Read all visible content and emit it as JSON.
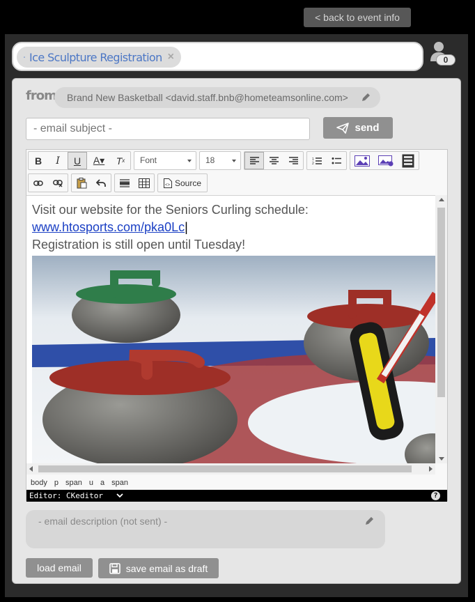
{
  "top": {
    "back_label": "< back to event info"
  },
  "recipients": {
    "chip_label": "Ice Sculpture Registration",
    "close_glyph": "×",
    "count": "0"
  },
  "from": {
    "label": "from:",
    "value": "Brand New Basketball  <david.staff.bnb@hometeamsonline.com>"
  },
  "subject": {
    "placeholder": "- email subject -"
  },
  "send": {
    "label": "send"
  },
  "toolbar": {
    "font_label": "Font",
    "size_label": "18",
    "source_label": "Source"
  },
  "content": {
    "line1": "Visit our website for the Seniors Curling schedule:",
    "link": "www.htosports.com/pka0Lc",
    "line3": "Registration is still open until Tuesday!"
  },
  "path_bar": [
    "body",
    "p",
    "span",
    "u",
    "a",
    "span"
  ],
  "status": {
    "editor_label": "Editor: CKeditor",
    "help": "?"
  },
  "description": {
    "placeholder": "- email description (not sent) -"
  },
  "buttons": {
    "load": "load email",
    "draft": "save email as draft"
  },
  "colors": {
    "accent_blue": "#4c77c5",
    "button_gray": "#909090",
    "link": "#1a3fc4"
  }
}
